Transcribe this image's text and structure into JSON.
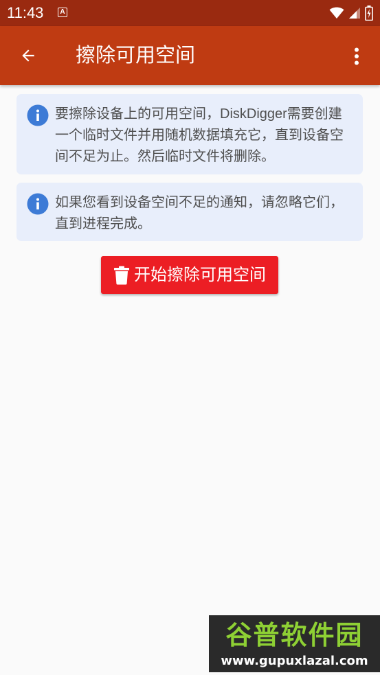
{
  "status_bar": {
    "time": "11:43",
    "notification_icon": "A"
  },
  "app_bar": {
    "title": "擦除可用空间",
    "back_icon": "arrow-left-icon",
    "menu_icon": "more-vert-icon"
  },
  "info_cards": [
    {
      "icon": "info-icon",
      "text": "要擦除设备上的可用空间，DiskDigger需要创建一个临时文件并用随机数据填充它，直到设备空间不足为止。然后临时文件将删除。"
    },
    {
      "icon": "info-icon",
      "text": "如果您看到设备空间不足的通知，请忽略它们，直到进程完成。"
    }
  ],
  "wipe_button": {
    "icon": "trash-icon",
    "label": "开始擦除可用空间"
  },
  "watermark": {
    "logo": "谷普软件园",
    "url": "www.gupuxlazal.com"
  },
  "colors": {
    "status_bar": "#9a2a10",
    "app_bar": "#bf3b12",
    "info_card_bg": "#e8eefb",
    "info_icon": "#3d7bd6",
    "button": "#ec1e24"
  }
}
